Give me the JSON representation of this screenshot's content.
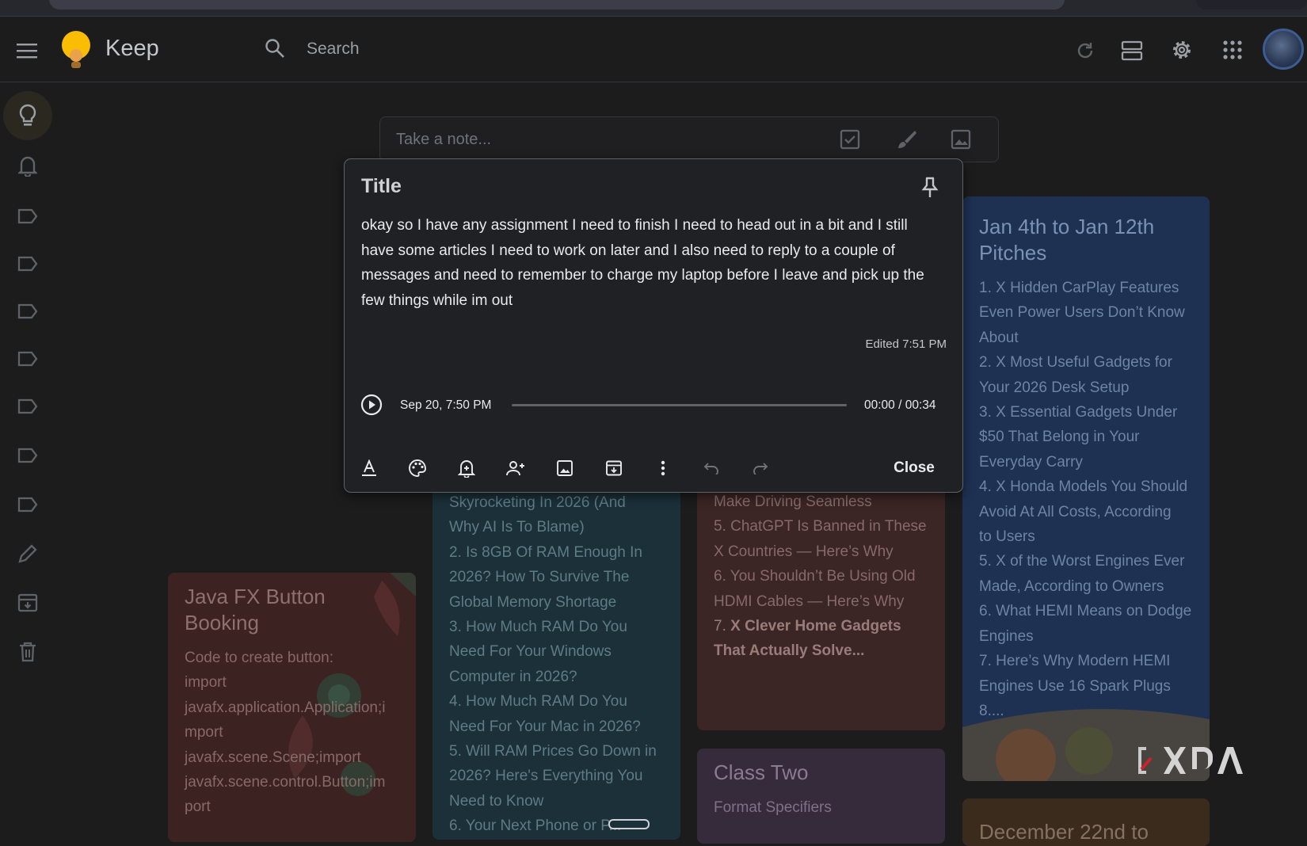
{
  "app": {
    "name": "Keep"
  },
  "search": {
    "placeholder": "Search"
  },
  "take_note": {
    "placeholder": "Take a note..."
  },
  "editor": {
    "title_placeholder": "Title",
    "body": "okay so I have any assignment I need to finish I need to head out in a bit and I still have some articles I need to work on later and I also need to reply to a couple of messages and need to remember to charge my laptop before I leave and pick up the few things while im out",
    "edited": "Edited 7:51 PM",
    "audio": {
      "date": "Sep 20, 7:50 PM",
      "time": "00:00 / 00:34",
      "progress": 0
    },
    "close_label": "Close"
  },
  "notes": {
    "pitches": {
      "title": "Jan 4th to Jan 12th Pitches",
      "lines": [
        "1. X Hidden CarPlay Features",
        "Even Power Users Don’t Know",
        "About",
        "2. X Most Useful Gadgets for",
        "Your 2026 Desk Setup",
        "3. X Essential Gadgets Under",
        "$50 That Belong in Your",
        "Everyday Carry",
        "4. X Honda Models You Should",
        "Avoid At All Costs, According",
        "to Users",
        "5. X of the Worst Engines Ever",
        "Made, According to Owners",
        "6. What HEMI Means on Dodge",
        "Engines",
        "7. Here’s Why Modern HEMI",
        "Engines Use 16 Spark Plugs",
        "8...."
      ]
    },
    "ram": {
      "lines": [
        "Skyrocketing In 2026 (And",
        "Why AI Is To Blame)",
        "2. Is 8GB Of RAM Enough In",
        "2026? How To Survive The",
        "Global Memory Shortage",
        "3. How Much RAM Do You",
        "Need For Your Windows",
        "Computer in 2026?",
        "4. How Much RAM Do You",
        "Need For Your Mac in 2026?",
        "5. Will RAM Prices Go Down in",
        "2026? Here's Everything You",
        "Need to Know",
        "6. Your Next Phone or P..."
      ]
    },
    "gadgets": {
      "lines": [
        "Make Driving Seamless",
        "5. ChatGPT Is Banned in These",
        "X Countries — Here’s Why",
        "6. You Shouldn’t Be Using Old",
        "HDMI Cables — Here’s Why"
      ],
      "bold_prefix": "7. ",
      "bold_lines": [
        "X Clever Home Gadgets",
        "That Actually Solve..."
      ]
    },
    "class_two": {
      "title": "Class Two",
      "lines": [
        "Format Specifiers"
      ]
    },
    "java": {
      "title": "Java FX Button Booking",
      "lines": [
        "Code to create button:",
        "import",
        "javafx.application.Application;i",
        "mport",
        "javafx.scene.Scene;import",
        "javafx.scene.control.Button;im",
        "port"
      ]
    },
    "december": {
      "title": "December 22nd to"
    }
  },
  "watermark": {
    "text": "XDA"
  },
  "colors": {
    "accent_yellow": "#fbbc04",
    "modal_bg": "#202124",
    "page_bg": "#1c1c1d"
  }
}
